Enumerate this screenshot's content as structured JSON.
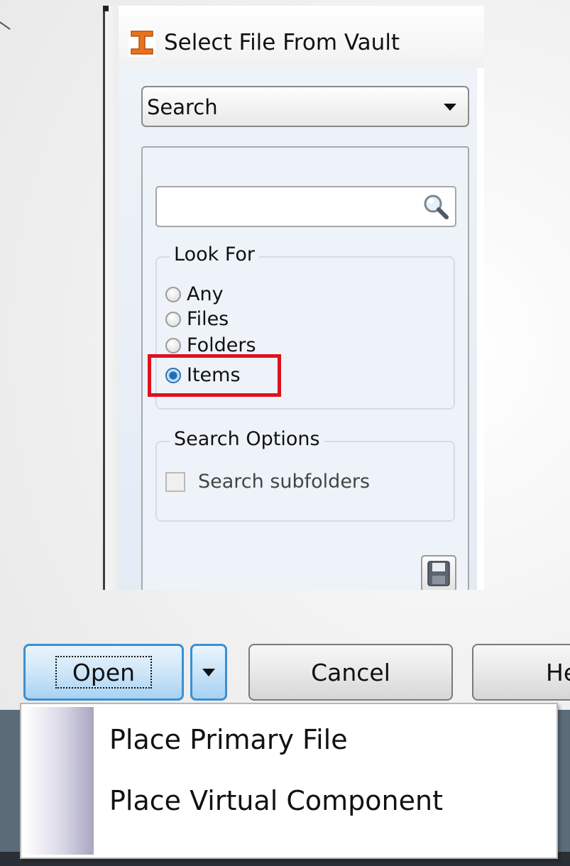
{
  "dialog": {
    "title": "Select File From Vault",
    "mode_select": {
      "value": "Search"
    },
    "search": {
      "value": "",
      "placeholder": ""
    },
    "look_for": {
      "legend": "Look For",
      "options": [
        "Any",
        "Files",
        "Folders",
        "Items"
      ],
      "selected": "Items"
    },
    "search_options": {
      "legend": "Search Options",
      "subfolders_label": "Search subfolders",
      "subfolders_checked": false
    }
  },
  "buttons": {
    "open": "Open",
    "cancel": "Cancel",
    "help": "He"
  },
  "open_menu": {
    "items": [
      "Place Primary File",
      "Place Virtual Component"
    ]
  },
  "colors": {
    "highlight": "#e0101e",
    "accent": "#3c8fd0",
    "app_icon": "#e8731c"
  }
}
